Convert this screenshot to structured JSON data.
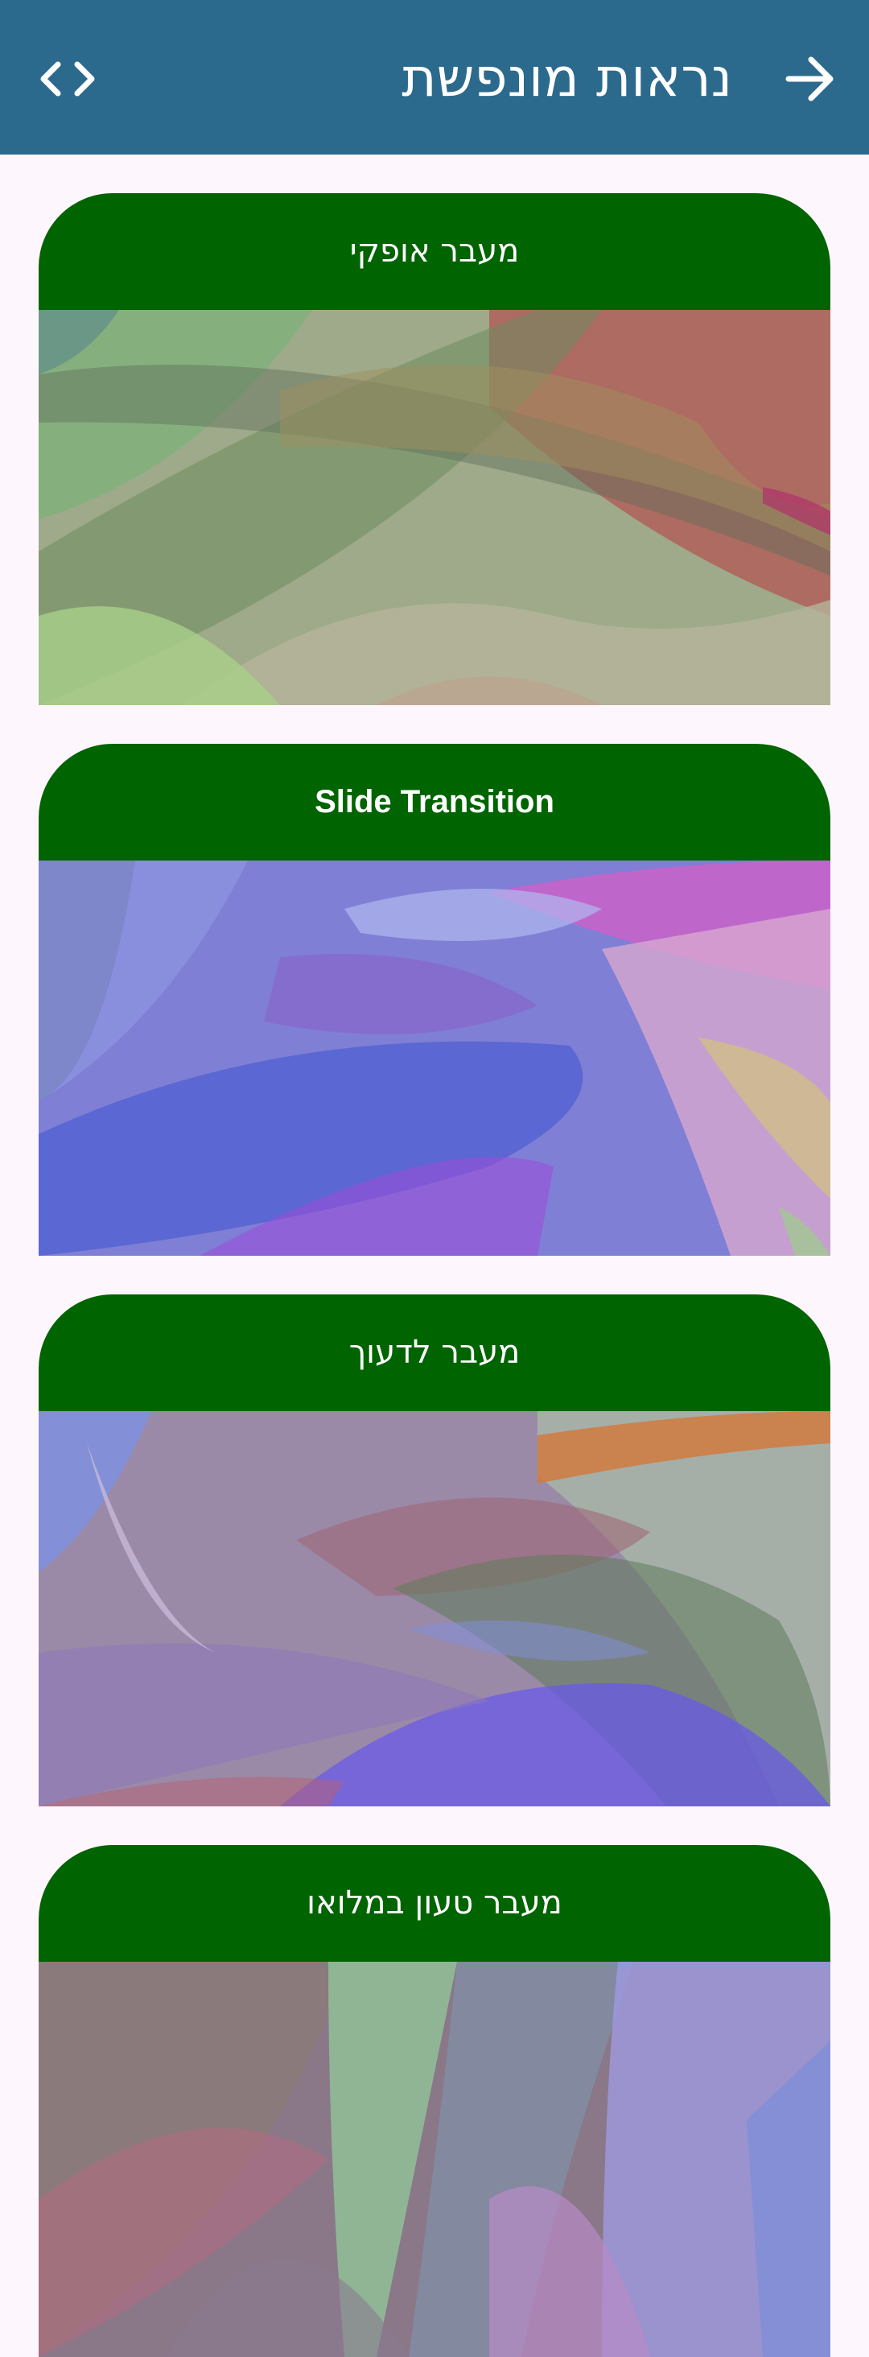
{
  "app_bar": {
    "title": "נראות מונפשת",
    "background_color": "#2c6a8d",
    "back_icon": "arrow-forward-icon",
    "code_icon": "code-brackets-icon"
  },
  "cards": [
    {
      "title": "מעבר אופקי",
      "image": "abstract-wave-image-green-red"
    },
    {
      "title": "Slide Transition",
      "image": "abstract-wave-image-blue-purple"
    },
    {
      "title": "מעבר לדעוך",
      "image": "abstract-wave-image-purple-grey"
    },
    {
      "title": "מעבר טעון במלואו",
      "image": "abstract-wave-image-mixed"
    }
  ],
  "colors": {
    "card_header": "#006400",
    "page_background": "#fdf7fd"
  }
}
